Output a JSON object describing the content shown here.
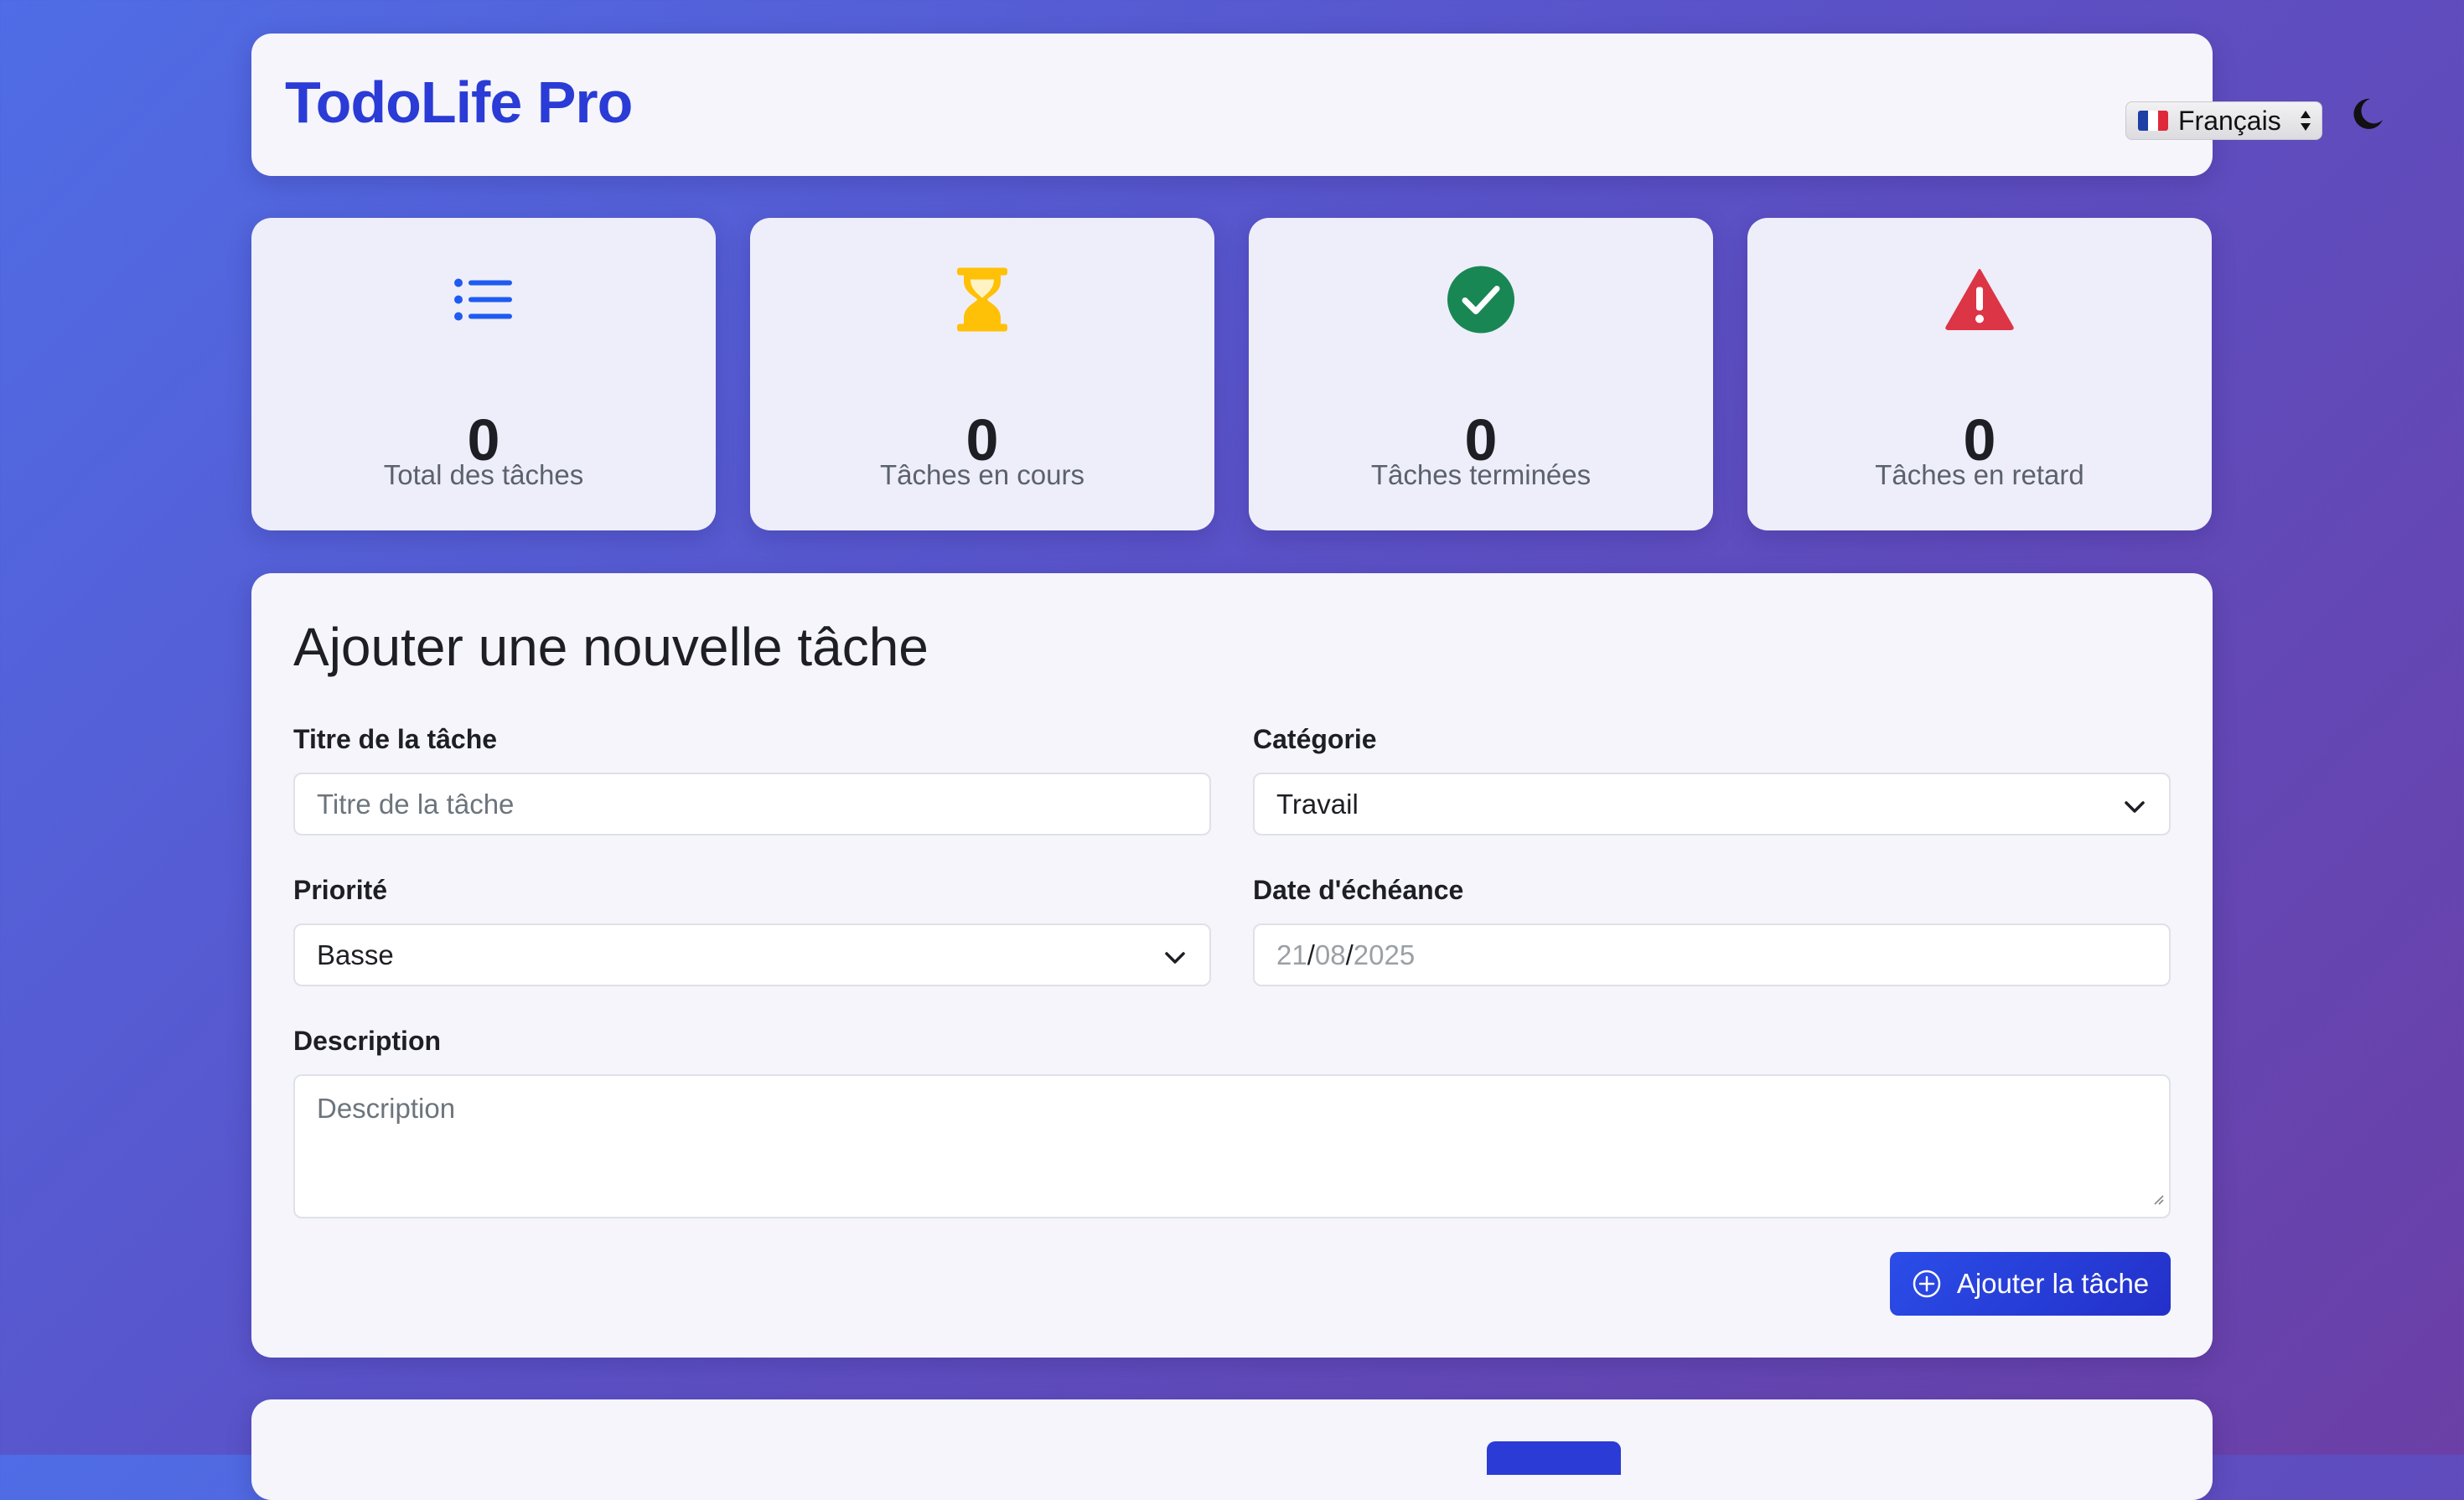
{
  "header": {
    "app_title": "TodoLife Pro",
    "language_select": {
      "value": "Français",
      "flag": "french-flag-icon"
    },
    "theme_toggle_icon": "moon-icon"
  },
  "stats": [
    {
      "icon": "list-icon",
      "value": "0",
      "label": "Total des tâches",
      "color": "#1f5bf0"
    },
    {
      "icon": "hourglass-icon",
      "value": "0",
      "label": "Tâches en cours",
      "color": "#ffc107"
    },
    {
      "icon": "check-circle-icon",
      "value": "0",
      "label": "Tâches terminées",
      "color": "#198754"
    },
    {
      "icon": "warning-triangle-icon",
      "value": "0",
      "label": "Tâches en retard",
      "color": "#dc3545"
    }
  ],
  "form": {
    "title": "Ajouter une nouvelle tâche",
    "task_title": {
      "label": "Titre de la tâche",
      "placeholder": "Titre de la tâche",
      "value": ""
    },
    "category": {
      "label": "Catégorie",
      "value": "Travail"
    },
    "priority": {
      "label": "Priorité",
      "value": "Basse"
    },
    "due_date": {
      "label": "Date d'échéance",
      "day": "21",
      "month": "08",
      "year": "2025",
      "separator": "/"
    },
    "description": {
      "label": "Description",
      "placeholder": "Description"
    },
    "submit_label": "Ajouter la tâche"
  },
  "colors": {
    "accent": "#2a3bd6",
    "button": "#2b4de8"
  }
}
